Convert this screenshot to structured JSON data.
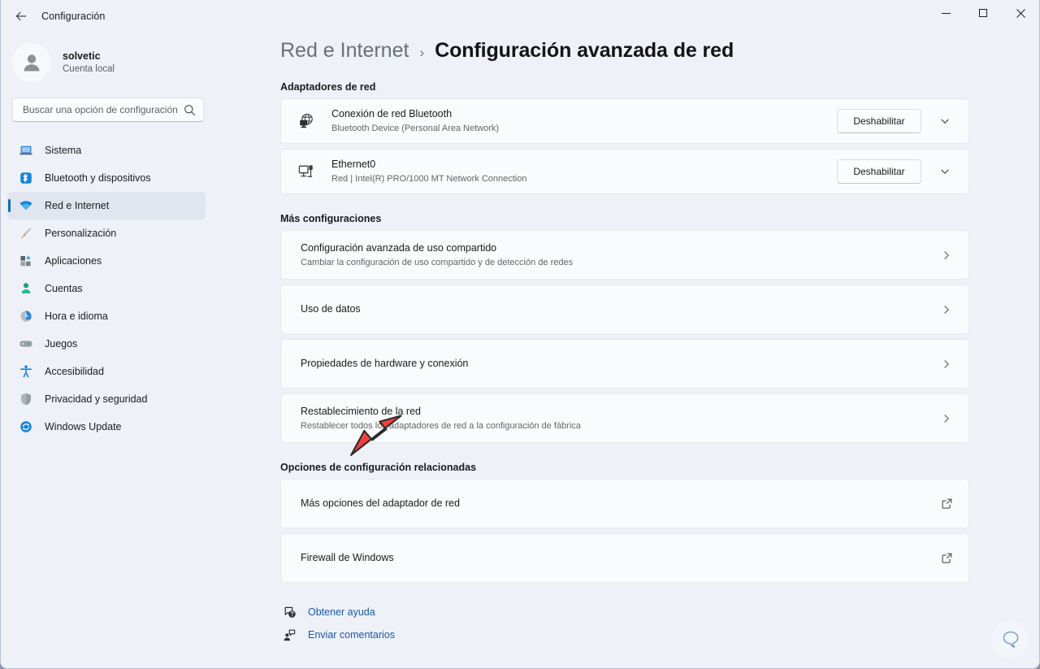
{
  "window": {
    "app_title": "Configuración",
    "back_icon": "arrow-left-icon",
    "minimize_label": "—",
    "maximize_label": "□",
    "close_label": "✕",
    "accent_color": "#0f6cbd",
    "background_color": "#eef1f8",
    "card_color": "#fafbfc",
    "link_color": "#1c58a8",
    "annotation_color": "#f4403c"
  },
  "sidebar": {
    "profile": {
      "name": "solvetic",
      "subtitle": "Cuenta local",
      "avatar_icon": "person-avatar-icon"
    },
    "search": {
      "placeholder": "Buscar una opción de configuración",
      "value": "",
      "icon": "search-icon"
    },
    "items": [
      {
        "label": "Sistema",
        "icon": "laptop-icon",
        "selected": false
      },
      {
        "label": "Bluetooth y dispositivos",
        "icon": "bluetooth-icon",
        "selected": false
      },
      {
        "label": "Red e Internet",
        "icon": "wifi-icon",
        "selected": true
      },
      {
        "label": "Personalización",
        "icon": "paintbrush-icon",
        "selected": false
      },
      {
        "label": "Aplicaciones",
        "icon": "apps-icon",
        "selected": false
      },
      {
        "label": "Cuentas",
        "icon": "person-icon",
        "selected": false
      },
      {
        "label": "Hora e idioma",
        "icon": "clock-icon",
        "selected": false
      },
      {
        "label": "Juegos",
        "icon": "gamepad-icon",
        "selected": false
      },
      {
        "label": "Accesibilidad",
        "icon": "accessibility-icon",
        "selected": false
      },
      {
        "label": "Privacidad y seguridad",
        "icon": "shield-icon",
        "selected": false
      },
      {
        "label": "Windows Update",
        "icon": "update-icon",
        "selected": false
      }
    ]
  },
  "main": {
    "breadcrumb": {
      "parent": "Red e Internet",
      "separator": "›",
      "current": "Configuración avanzada de red"
    },
    "sections": [
      {
        "label": "Adaptadores de red",
        "type": "adapters",
        "rows": [
          {
            "icon": "network-globe-icon",
            "title": "Conexión de red Bluetooth",
            "subtitle": "Bluetooth Device (Personal Area Network)",
            "button": "Deshabilitar",
            "expander_icon": "chevron-down-icon"
          },
          {
            "icon": "ethernet-icon",
            "title": "Ethernet0",
            "subtitle": "Red | Intel(R) PRO/1000 MT Network Connection",
            "button": "Deshabilitar",
            "expander_icon": "chevron-down-icon"
          }
        ]
      },
      {
        "label": "Más configuraciones",
        "type": "navigation",
        "rows": [
          {
            "title": "Configuración avanzada de uso compartido",
            "subtitle": "Cambiar la configuración de uso compartido y de detección de redes",
            "action_icon": "chevron-right-icon"
          },
          {
            "title": "Uso de datos",
            "subtitle": "",
            "action_icon": "chevron-right-icon"
          },
          {
            "title": "Propiedades de hardware y conexión",
            "subtitle": "",
            "action_icon": "chevron-right-icon"
          },
          {
            "title": "Restablecimiento de la red",
            "subtitle": "Restablecer todos los adaptadores de red a la configuración de fábrica",
            "action_icon": "chevron-right-icon"
          }
        ]
      },
      {
        "label": "Opciones de configuración relacionadas",
        "type": "external",
        "rows": [
          {
            "title": "Más opciones del adaptador de red",
            "subtitle": "",
            "action_icon": "external-link-icon"
          },
          {
            "title": "Firewall de Windows",
            "subtitle": "",
            "action_icon": "external-link-icon"
          }
        ]
      }
    ],
    "footer_links": [
      {
        "label": "Obtener ayuda",
        "icon": "help-question-icon"
      },
      {
        "label": "Enviar comentarios",
        "icon": "feedback-person-icon"
      }
    ]
  },
  "overlays": {
    "annotation_arrow": {
      "name": "red-arrow-annotation",
      "points_to": "Restablecimiento de la red",
      "color": "#f4403c",
      "direction": "up-right"
    },
    "feedback_bubble_icon": "feedback-bubble-icon"
  }
}
